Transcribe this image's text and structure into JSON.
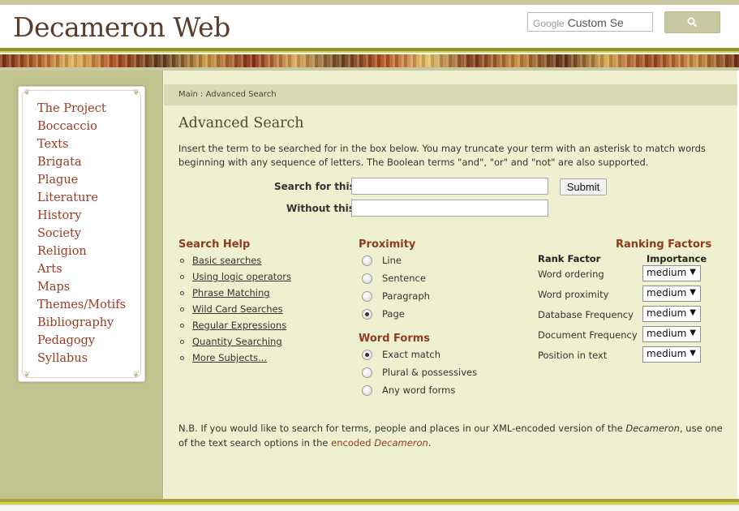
{
  "header": {
    "site_title": "Decameron Web",
    "search_brand": "Google",
    "search_text": "Custom Se",
    "search_button_icon": "magnifier-icon"
  },
  "sidebar": {
    "items": [
      "The Project",
      "Boccaccio",
      "Texts",
      "Brigata",
      "Plague",
      "Literature",
      "History",
      "Society",
      "Religion",
      "Arts",
      "Maps",
      "Themes/Motifs",
      "Bibliography",
      "Pedagogy",
      "Syllabus"
    ]
  },
  "breadcrumb": "Main : Advanced Search",
  "main": {
    "title": "Advanced Search",
    "intro": "Insert the term to be searched for in the box below. You may truncate your term with an asterisk to match words beginning with any sequence of letters. The Boolean terms \"and\", \"or\" and \"not\" are also supported.",
    "search_for_label": "Search for this:",
    "without_label": "Without this:",
    "submit_label": "Submit"
  },
  "search_help": {
    "title": "Search Help",
    "links": [
      "Basic searches",
      "Using logic operators",
      "Phrase Matching",
      "Wild Card Searches",
      "Regular Expressions",
      "Quantity Searching",
      "More Subjects..."
    ]
  },
  "proximity": {
    "title": "Proximity",
    "options": [
      "Line",
      "Sentence",
      "Paragraph",
      "Page"
    ],
    "selected": "Page"
  },
  "word_forms": {
    "title": "Word Forms",
    "options": [
      "Exact match",
      "Plural & possessives",
      "Any word forms"
    ],
    "selected": "Exact match"
  },
  "ranking": {
    "title": "Ranking Factors",
    "col_factor": "Rank Factor",
    "col_importance": "Importance",
    "rows": [
      {
        "factor": "Word ordering",
        "value": "medium"
      },
      {
        "factor": "Word proximity",
        "value": "medium"
      },
      {
        "factor": "Database Frequency",
        "value": "medium"
      },
      {
        "factor": "Document Frequency",
        "value": "medium"
      },
      {
        "factor": "Position in text",
        "value": "medium"
      }
    ]
  },
  "note": {
    "prefix": "N.B. If you would like to search for terms, people and places in our XML-encoded version of the ",
    "work_title": "Decameron",
    "middle": ", use one of the text search options in the ",
    "link_text": "encoded ",
    "link_title": "Decameron",
    "suffix": "."
  },
  "colors": {
    "accent": "#8e3b1e",
    "sidebar_bg": "#c2c48f",
    "main_bg": "#eef0cf",
    "olive": "#8f8d2e"
  }
}
